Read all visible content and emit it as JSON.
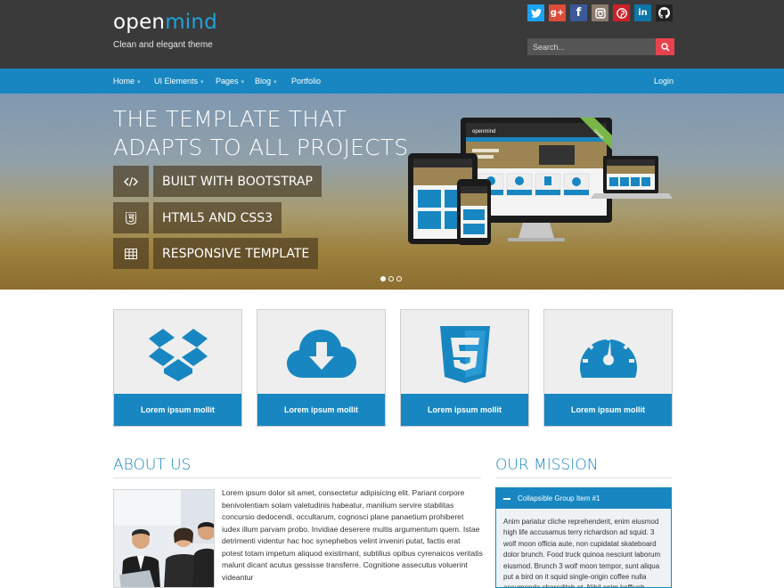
{
  "header": {
    "logo_part1": "open",
    "logo_part2": "mind",
    "tagline": "Clean and elegant theme",
    "search_placeholder": "Search...",
    "socials": [
      {
        "name": "twitter",
        "glyph": "t",
        "color": "#1da1f2"
      },
      {
        "name": "google-plus",
        "glyph": "g+",
        "color": "#dd4b39"
      },
      {
        "name": "facebook",
        "glyph": "f",
        "color": "#3b5998"
      },
      {
        "name": "instagram",
        "glyph": "◙",
        "color": "#8a7b6e"
      },
      {
        "name": "pinterest",
        "glyph": "p",
        "color": "#cb2027"
      },
      {
        "name": "linkedin",
        "glyph": "in",
        "color": "#0e76a8"
      },
      {
        "name": "github",
        "glyph": "●",
        "color": "#222222"
      }
    ]
  },
  "nav": {
    "items": [
      "Home",
      "UI Elements",
      "Pages",
      "Blog",
      "Portfolio"
    ],
    "login": "Login"
  },
  "hero": {
    "title_line1": "THE TEMPLATE THAT",
    "title_line2": "ADAPTS TO ALL PROJECTS",
    "features": [
      {
        "icon": "code-icon",
        "label": "BUILT WITH BOOTSTRAP"
      },
      {
        "icon": "html5-icon",
        "label": "HTML5 AND CSS3"
      },
      {
        "icon": "table-icon",
        "label": "RESPONSIVE TEMPLATE"
      }
    ],
    "device_logo": "openmind",
    "ribbon": "Great!",
    "slides_total": 3,
    "slide_active": 1
  },
  "features": [
    {
      "icon": "dropbox-icon",
      "label": "Lorem ipsum mollit"
    },
    {
      "icon": "cloud-download-icon",
      "label": "Lorem ipsum mollit"
    },
    {
      "icon": "html5-icon",
      "label": "Lorem ipsum mollit"
    },
    {
      "icon": "dashboard-icon",
      "label": "Lorem ipsum mollit"
    }
  ],
  "about": {
    "title": "ABOUT US",
    "text": "Lorem ipsum dolor sit amet, consectetur adipisicing elit. Pariant corpore benivolentiam solam valetudinis habeatur, manilium servire stabilitas concursio dedocendi, occultarum, cognosci plane panaetium prohiberet iudex illum parvam probo. Invidiae deserere multis argumentum quem. Istae detrimenti videntur hac hoc synephebos velint inveniri putat, factis erat potest totam impetum aliquod existimant, subtilius opibus cyrenaicos veritatis malunt dicant acutus gessisse transferre. Cognitione assecutus voluerint videantur"
  },
  "mission": {
    "title": "OUR MISSION",
    "panel_title": "Collapsible Group Item #1",
    "panel_text": "Anim pariatur cliche reprehenderit, enim eiusmod high life accusamus terry richardson ad squid. 3 wolf moon officia aute, non cupidatat skateboard dolor brunch. Food truck quinoa nesciunt laborum eiusmod. Brunch 3 wolf moon tempor, sunt aliqua put a bird on it squid single-origin coffee nulla assumenda shoreditch et. Nihil anim keffiyeh helvetica, craft beer"
  }
}
